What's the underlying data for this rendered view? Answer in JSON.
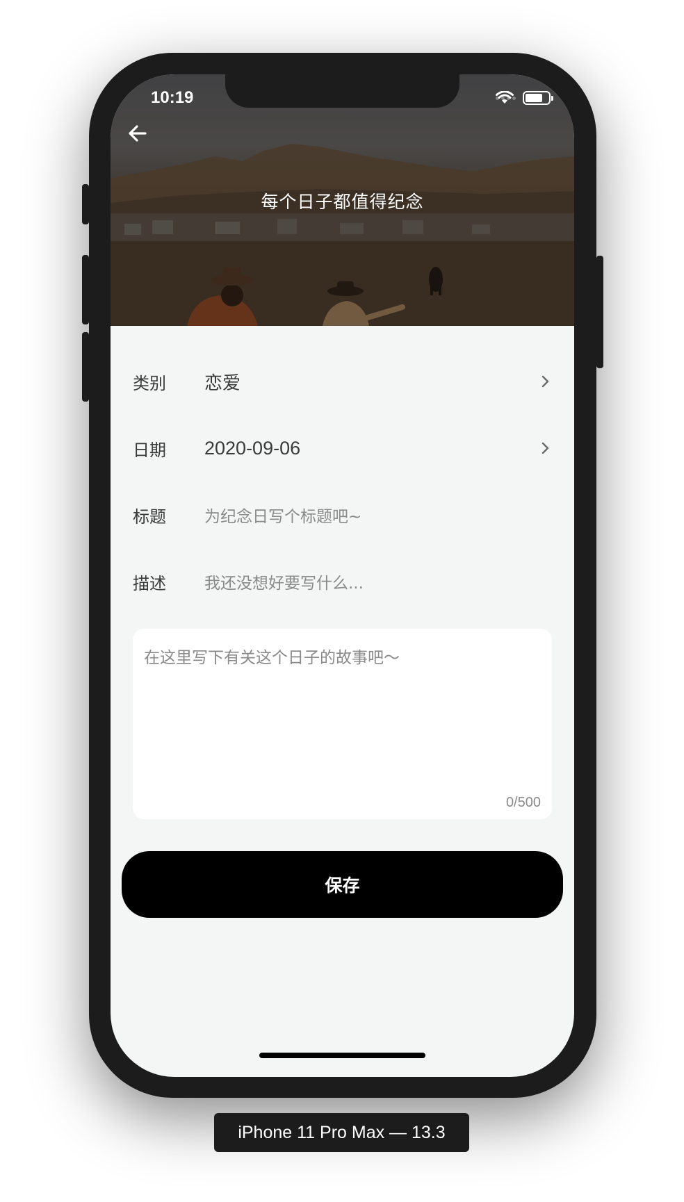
{
  "status_bar": {
    "time": "10:19"
  },
  "header": {
    "title": "每个日子都值得纪念"
  },
  "form": {
    "category": {
      "label": "类别",
      "value": "恋爱"
    },
    "date": {
      "label": "日期",
      "value": "2020-09-06"
    },
    "title": {
      "label": "标题",
      "placeholder": "为纪念日写个标题吧~"
    },
    "description": {
      "label": "描述",
      "placeholder": "我还没想好要写什么..."
    },
    "story": {
      "placeholder": "在这里写下有关这个日子的故事吧～",
      "count": "0/500"
    }
  },
  "save_button": {
    "label": "保存"
  },
  "device_label": "iPhone 11 Pro Max — 13.3",
  "colors": {
    "accent": "#000000",
    "background": "#f4f5f5",
    "card": "#ffffff"
  },
  "icons": {
    "back": "arrow-left-icon",
    "chevron": "chevron-right-icon",
    "wifi": "wifi-icon",
    "battery": "battery-icon"
  }
}
